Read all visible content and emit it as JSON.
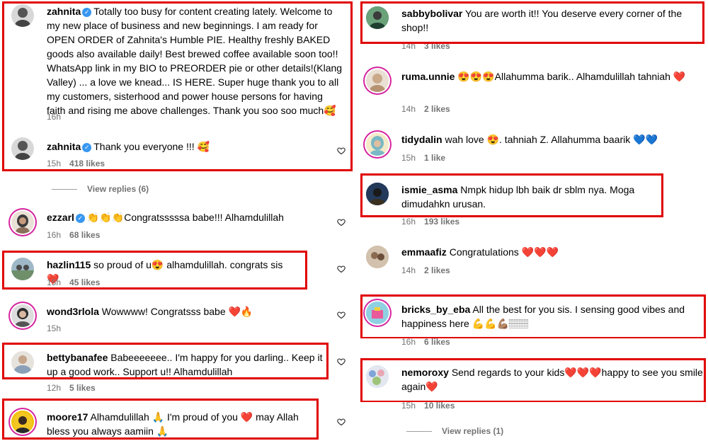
{
  "left": {
    "c1": {
      "user": "zahnita",
      "text": "Totally too busy for content creating lately. Welcome to my new place of business and new beginnings. I am ready for OPEN ORDER of Zahnita's Humble PIE. Healthy freshly BAKED goods also available daily! Best brewed coffee available soon too!! WhatsApp link in my BIO to PREORDER pie or other details!(Klang Valley) ... a love we knead... IS HERE. Super huge thank you to all my customers, sisterhood and power house persons for having faith and rising me above challenges. Thank you soo soo much🥰",
      "time": "16h"
    },
    "c2": {
      "user": "zahnita",
      "text": "Thank you everyone !!! 🥰",
      "time": "15h",
      "likes": "418 likes"
    },
    "view_replies": "View replies (6)",
    "c3": {
      "user": "ezzarl",
      "text": "👏👏👏Congratsssssa babe!!! Alhamdulillah",
      "time": "16h",
      "likes": "68 likes"
    },
    "c4": {
      "user": "hazlin115",
      "text": "so proud of u😍 alhamdulillah. congrats sis❤️",
      "time": "15h",
      "likes": "45 likes"
    },
    "c5": {
      "user": "wond3rlola",
      "text": "Wowwww! Congratsss babe ❤️🔥",
      "time": "15h"
    },
    "c6": {
      "user": "bettybanafee",
      "text": "Babeeeeeee.. I'm happy for you darling.. Keep it up a good work.. Support u!! Alhamdulillah",
      "time": "12h",
      "likes": "5 likes"
    },
    "c7": {
      "user": "moore17",
      "text": "Alhamdulillah 🙏 I'm proud of you ❤️ may Allah bless you always aamiin 🙏"
    }
  },
  "right": {
    "r1": {
      "user": "sabbybolivar",
      "text": "You are worth it!! You deserve every corner of the shop!!",
      "time": "14h",
      "likes": "3 likes"
    },
    "r2": {
      "user": "ruma.unnie",
      "text": "😍😍😍Allahumma barik.. Alhamdulillah tahniah ❤️",
      "time": "14h",
      "likes": "2 likes"
    },
    "r3": {
      "user": "tidydalin",
      "text": "wah love 😍. tahniah Z. Allahumma baarik 💙💙",
      "time": "15h",
      "likes": "1 like"
    },
    "r4": {
      "user": "ismie_asma",
      "text": "Nmpk hidup lbh baik dr sblm nya. Moga dimudahkn urusan.",
      "time": "16h",
      "likes": "193 likes"
    },
    "r5": {
      "user": "emmaafiz",
      "text": "Congratulations ❤️❤️❤️",
      "time": "14h",
      "likes": "2 likes"
    },
    "r6": {
      "user": "bricks_by_eba",
      "text": "All the best for you sis. I sensing good vibes and happiness here 💪💪💪🏽🏽🏽",
      "time": "16h",
      "likes": "6 likes"
    },
    "r7": {
      "user": "nemoroxy",
      "text": "Send regards to your kids❤️❤️❤️happy to see you smile again❤️",
      "time": "15h",
      "likes": "10 likes"
    },
    "view_replies": "View replies (1)"
  },
  "colors": {
    "highlight": "#e00000",
    "verified": "#3897f0",
    "meta": "#737373"
  },
  "icons": [
    "heart-icon",
    "verified-badge-icon"
  ]
}
